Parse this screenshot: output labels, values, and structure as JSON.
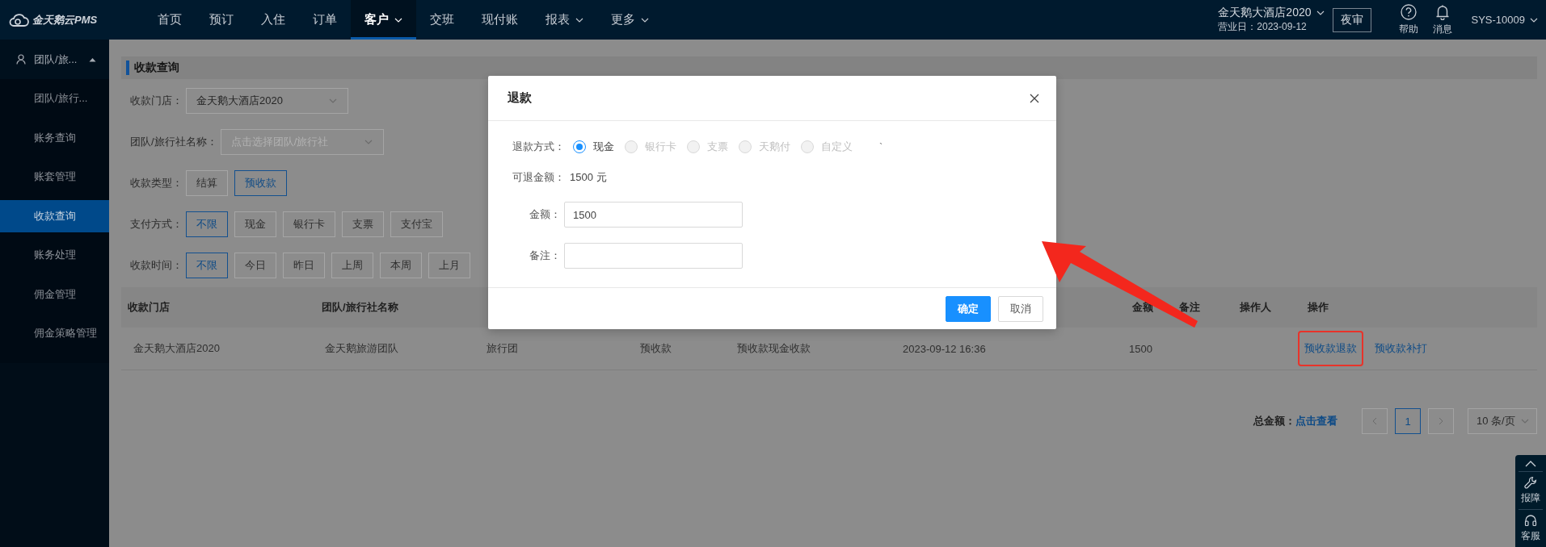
{
  "topbar": {
    "logo": "金天鹅云PMS",
    "nav": [
      {
        "label": "首页",
        "selected": false,
        "dropdown": false
      },
      {
        "label": "预订",
        "selected": false,
        "dropdown": false
      },
      {
        "label": "入住",
        "selected": false,
        "dropdown": false
      },
      {
        "label": "订单",
        "selected": false,
        "dropdown": false
      },
      {
        "label": "客户",
        "selected": true,
        "dropdown": true
      },
      {
        "label": "交班",
        "selected": false,
        "dropdown": false
      },
      {
        "label": "现付账",
        "selected": false,
        "dropdown": false
      },
      {
        "label": "报表",
        "selected": false,
        "dropdown": true
      },
      {
        "label": "更多",
        "selected": false,
        "dropdown": true
      }
    ],
    "hotel": "金天鹅大酒店2020",
    "business_date": "营业日：2023-09-12",
    "night_audit": "夜审",
    "help": "帮助",
    "messages": "消息",
    "user": "SYS-10009"
  },
  "sidebar": {
    "group": {
      "label": "团队/旅...",
      "expanded": true
    },
    "items": [
      {
        "label": "团队/旅行...",
        "selected": false
      },
      {
        "label": "账务查询",
        "selected": false
      },
      {
        "label": "账套管理",
        "selected": false
      },
      {
        "label": "收款查询",
        "selected": true
      },
      {
        "label": "账务处理",
        "selected": false
      },
      {
        "label": "佣金管理",
        "selected": false
      },
      {
        "label": "佣金策略管理",
        "selected": false
      }
    ]
  },
  "page": {
    "title": "收款查询",
    "filters": [
      {
        "kind": "select",
        "label": "收款门店：",
        "value": "金天鹅大酒店2020"
      },
      {
        "kind": "select",
        "label": "团队/旅行社名称：",
        "placeholder": "点击选择团队/旅行社"
      },
      {
        "kind": "options",
        "label": "收款类型：",
        "options": [
          {
            "label": "结算",
            "selected": false
          },
          {
            "label": "预收款",
            "selected": true
          }
        ]
      },
      {
        "kind": "options",
        "label": "支付方式：",
        "options": [
          {
            "label": "不限",
            "selected": true
          },
          {
            "label": "现金",
            "selected": false
          },
          {
            "label": "银行卡",
            "selected": false
          },
          {
            "label": "支票",
            "selected": false
          },
          {
            "label": "支付宝",
            "selected": false
          }
        ]
      },
      {
        "kind": "options",
        "label": "收款时间：",
        "options": [
          {
            "label": "不限",
            "selected": true
          },
          {
            "label": "今日",
            "selected": false
          },
          {
            "label": "昨日",
            "selected": false
          },
          {
            "label": "上周",
            "selected": false
          },
          {
            "label": "本周",
            "selected": false
          },
          {
            "label": "上月",
            "selected": false
          }
        ]
      }
    ],
    "table": {
      "columns": [
        "收款门店",
        "团队/旅行社名称"
      ],
      "columns_right": [
        "金额",
        "备注",
        "操作人",
        "操作"
      ],
      "rows": [
        {
          "cells": [
            "金天鹅大酒店2020",
            "金天鹅旅游团队",
            "旅行团",
            "预收款",
            "预收款现金收款",
            "2023-09-12 16:36",
            "1500"
          ],
          "actions": [
            {
              "label": "预收款退款",
              "highlighted": true
            },
            {
              "label": "预收款补打",
              "highlighted": false
            }
          ]
        }
      ]
    },
    "pagination": {
      "total_label": "总金额：",
      "total_link": "点击查看",
      "pages": [
        {
          "label": "1",
          "selected": true
        }
      ],
      "page_size": "10 条/页"
    }
  },
  "refund_dialog": {
    "title": "退款",
    "method_label": "退款方式：",
    "methods": [
      {
        "label": "现金",
        "selected": true,
        "disabled": false
      },
      {
        "label": "银行卡",
        "selected": false,
        "disabled": true
      },
      {
        "label": "支票",
        "selected": false,
        "disabled": true
      },
      {
        "label": "天鹅付",
        "selected": false,
        "disabled": true
      },
      {
        "label": "自定义",
        "selected": false,
        "disabled": true
      }
    ],
    "stray_mark": "`",
    "refundable_label": "可退金额：",
    "refundable_value": "1500 元",
    "fields": [
      {
        "label": "金额：",
        "value": "1500"
      },
      {
        "label": "备注："
      }
    ],
    "confirm": "确定",
    "cancel": "取消"
  },
  "help_widget": {
    "items": [
      {
        "kind": "top"
      },
      {
        "kind": "report",
        "label": "报障"
      },
      {
        "kind": "support",
        "label": "客服"
      }
    ]
  },
  "annotation_arrow": true
}
